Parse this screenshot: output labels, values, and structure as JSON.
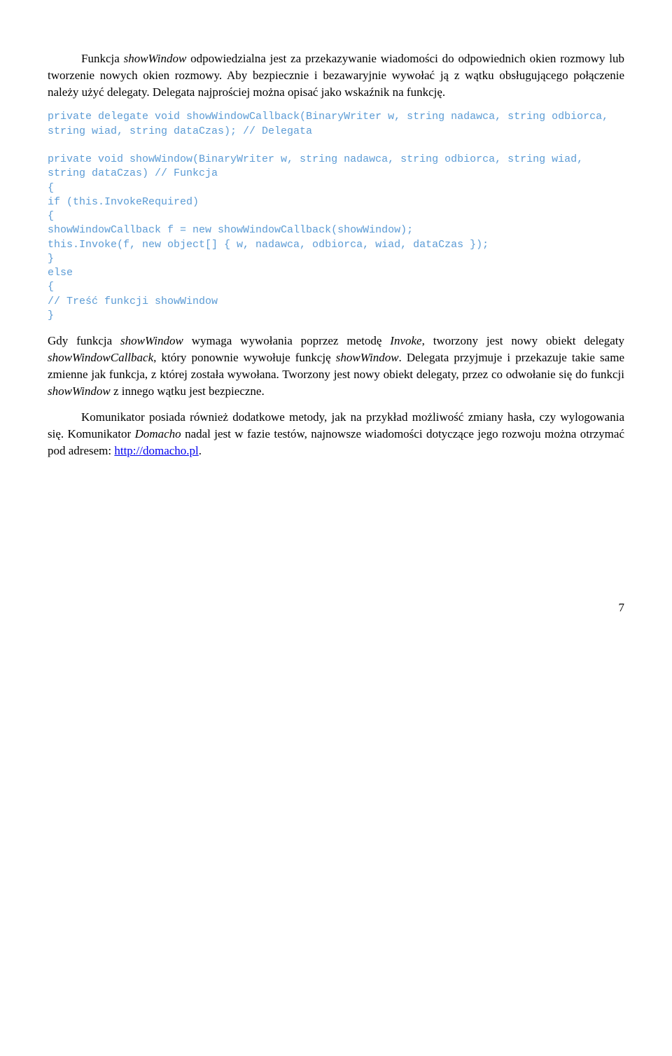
{
  "para1_a": "Funkcja ",
  "para1_b": "showWindow",
  "para1_c": " odpowiedzialna jest za przekazywanie wiadomości do odpowiednich okien rozmowy lub tworzenie nowych okien rozmowy. Aby bezpiecznie i bezawaryjnie wywołać ją z wątku obsługującego połączenie należy użyć delegaty. Delegata najprościej można opisać jako wskaźnik na funkcję.",
  "code": "private delegate void showWindowCallback(BinaryWriter w, string nadawca, string odbiorca, string wiad, string dataCzas); // Delegata\n\nprivate void showWindow(BinaryWriter w, string nadawca, string odbiorca, string wiad, string dataCzas) // Funkcja\n{\nif (this.InvokeRequired)\n{\nshowWindowCallback f = new showWindowCallback(showWindow);\nthis.Invoke(f, new object[] { w, nadawca, odbiorca, wiad, dataCzas });\n}\nelse\n{\n// Treść funkcji showWindow\n}",
  "para2_a": "Gdy funkcja ",
  "para2_b": "showWindow",
  "para2_c": " wymaga wywołania poprzez metodę ",
  "para2_d": "Invoke",
  "para2_e": ", tworzony jest nowy obiekt delegaty ",
  "para2_f": "showWindowCallback",
  "para2_g": ", który ponownie wywołuje funkcję ",
  "para2_h": "showWindow",
  "para2_i": ". Delegata przyjmuje i przekazuje takie same zmienne jak funkcja, z której została wywołana. Tworzony jest nowy obiekt delegaty, przez co odwołanie się do  funkcji ",
  "para2_j": "showWindow",
  "para2_k": " z innego wątku jest bezpieczne.",
  "para3_a": "Komunikator posiada również dodatkowe metody, jak na przykład możliwość zmiany hasła, czy wylogowania się. Komunikator ",
  "para3_b": "Domacho",
  "para3_c": " nadal jest w fazie testów, najnowsze wiadomości dotyczące jego rozwoju można otrzymać pod adresem: ",
  "para3_link": "http://domacho.pl",
  "para3_d": ".",
  "pagenum": "7"
}
